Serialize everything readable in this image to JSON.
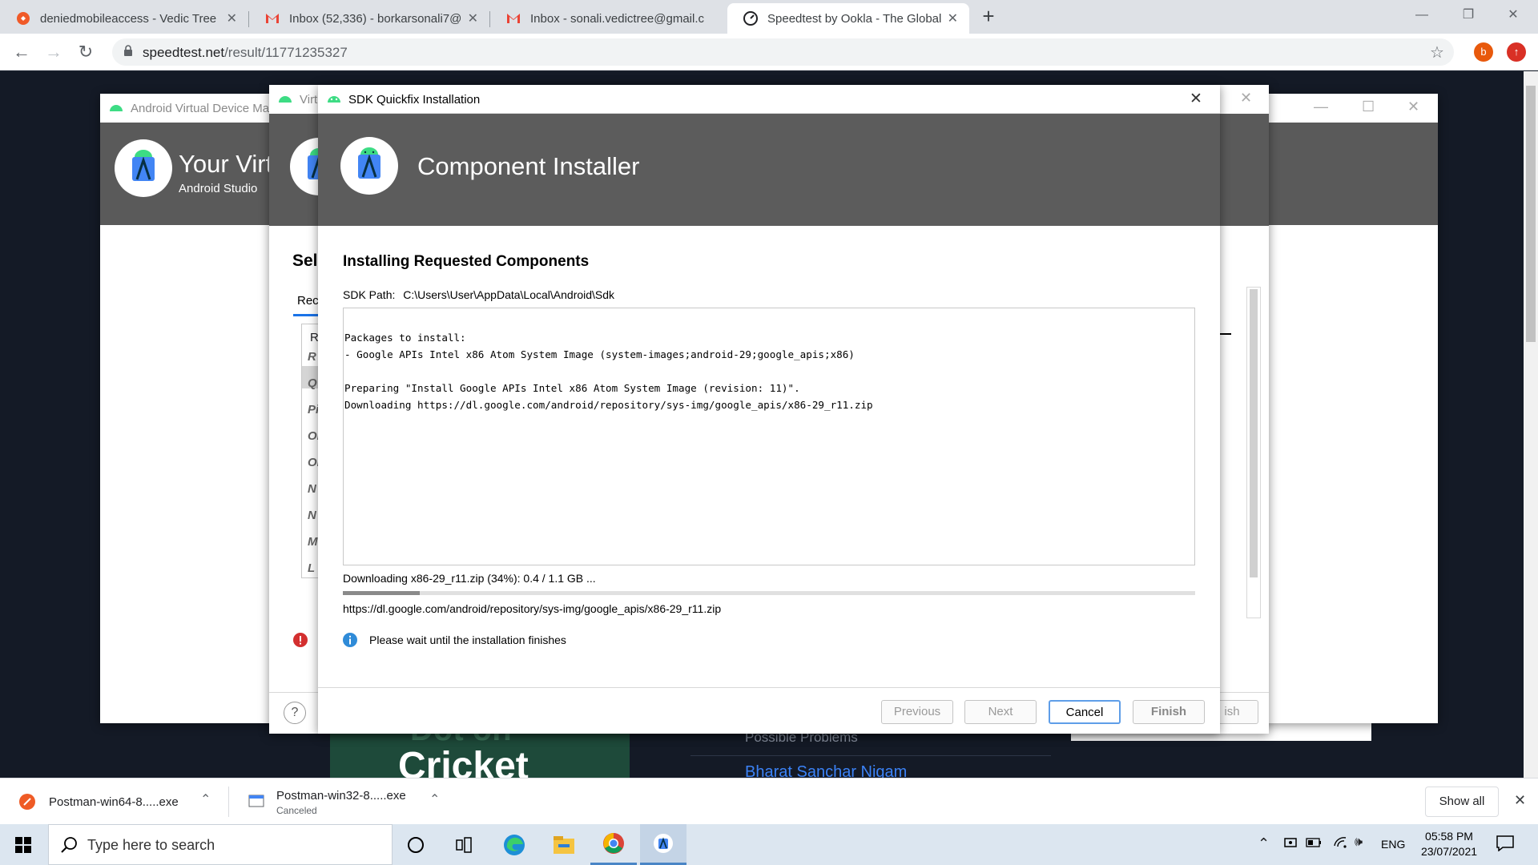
{
  "browser": {
    "tabs": [
      {
        "title": "deniedmobileaccess - Vedic Tree",
        "icon": "vedic-tree-icon",
        "active": false
      },
      {
        "title": "Inbox (52,336) - borkarsonali7@g",
        "icon": "gmail-icon",
        "active": false
      },
      {
        "title": "Inbox - sonali.vedictree@gmail.c",
        "icon": "gmail-icon",
        "active": false
      },
      {
        "title": "Speedtest by Ookla - The Global",
        "icon": "speedtest-icon",
        "active": true
      }
    ],
    "url_domain": "speedtest.net",
    "url_path": "/result/11771235327",
    "profile_letter": "b"
  },
  "avd_manager": {
    "title": "Android Virtual Device Ma",
    "header_title": "Your Virt",
    "header_subtitle": "Android Studio"
  },
  "system_image_dialog": {
    "title": "Virt",
    "section_heading": "Sele",
    "tab_label": "Rec",
    "column_header": "R",
    "list_items": [
      "R",
      "Q",
      "Pi",
      "Oi",
      "Oi",
      "N",
      "N",
      "M",
      "L"
    ],
    "finish_label": "ish"
  },
  "sdk_dialog": {
    "title": "SDK Quickfix Installation",
    "header_title": "Component Installer",
    "heading": "Installing Requested Components",
    "sdk_path_label": "SDK Path:",
    "sdk_path_value": "C:\\Users\\User\\AppData\\Local\\Android\\Sdk",
    "log_lines": [
      "Packages to install:",
      "- Google APIs Intel x86 Atom System Image (system-images;android-29;google_apis;x86)",
      "",
      "Preparing \"Install Google APIs Intel x86 Atom System Image (revision: 11)\".",
      "Downloading https://dl.google.com/android/repository/sys-img/google_apis/x86-29_r11.zip"
    ],
    "status_text": "Downloading x86-29_r11.zip (34%): 0.4 / 1.1 GB ...",
    "progress_fraction": 0.09,
    "download_url": "https://dl.google.com/android/repository/sys-img/google_apis/x86-29_r11.zip",
    "info_text": "Please wait until the installation finishes",
    "buttons": {
      "previous": "Previous",
      "next": "Next",
      "cancel": "Cancel",
      "finish": "Finish"
    },
    "help_label": "?"
  },
  "background_page": {
    "problems_text": "Possible Problems",
    "provider_text": "Bharat Sanchar Nigam",
    "banner_text_1": "Dot on",
    "banner_text_2": "Cricket"
  },
  "downloads_bar": {
    "items": [
      {
        "name": "Postman-win64-8.....exe",
        "status": ""
      },
      {
        "name": "Postman-win32-8.....exe",
        "status": "Canceled"
      }
    ],
    "show_all": "Show all"
  },
  "taskbar": {
    "search_placeholder": "Type here to search",
    "language": "ENG",
    "time": "05:58 PM",
    "date": "23/07/2021"
  },
  "colors": {
    "android_green": "#3ddc84",
    "dialog_header": "#5a5a5a",
    "page_bg": "#141a26",
    "accent_blue": "#1a73e8"
  }
}
